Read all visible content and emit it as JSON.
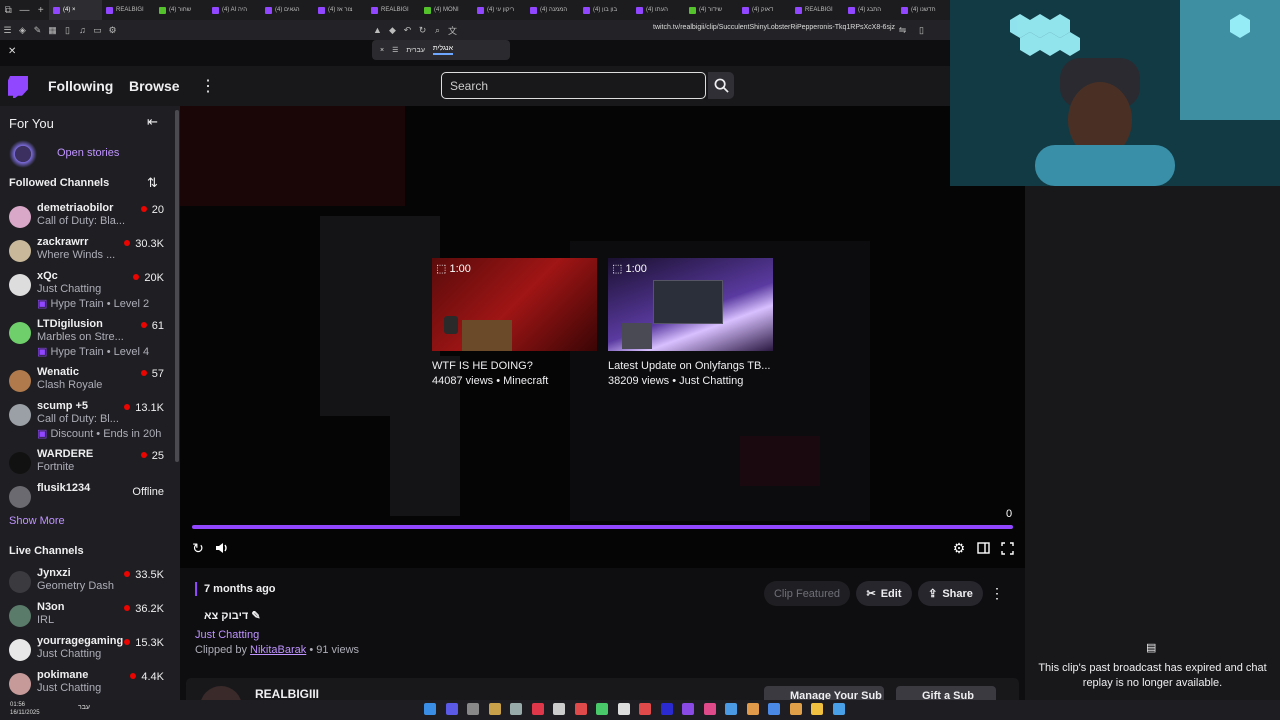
{
  "browser": {
    "tabs": [
      {
        "label": "(4) ×",
        "active": true,
        "color": "#9147ff"
      },
      {
        "label": "REALBIGI",
        "color": "#9147ff"
      },
      {
        "label": "(4) שחור",
        "color": "#53c22b"
      },
      {
        "label": "(4) AI היה",
        "color": "#9147ff"
      },
      {
        "label": "(4) הגאים",
        "color": "#9147ff"
      },
      {
        "label": "(4) צור אז",
        "color": "#9147ff"
      },
      {
        "label": "REALBIGI",
        "color": "#9147ff"
      },
      {
        "label": "(4) MONI",
        "color": "#53c22b"
      },
      {
        "label": "(4) ריקון עי",
        "color": "#9147ff"
      },
      {
        "label": "(4) הממנה",
        "color": "#9147ff"
      },
      {
        "label": "(4) בון בון",
        "color": "#9147ff"
      },
      {
        "label": "(4) העתו",
        "color": "#9147ff"
      },
      {
        "label": "(4) שידור",
        "color": "#53c22b"
      },
      {
        "label": "(4) דאוק",
        "color": "#9147ff"
      },
      {
        "label": "REALBIGI",
        "color": "#9147ff"
      },
      {
        "label": "(4) התבג",
        "color": "#9147ff"
      },
      {
        "label": "(4) חדשנו",
        "color": "#9147ff"
      }
    ],
    "url": "twitch.tv/realbigii/clip/SucculentShinyLobsterRiPepperonis-Tkq1RPsXcX8-6sjz",
    "translate": {
      "left": "עברית",
      "right": "אנגלית"
    }
  },
  "nav": {
    "following": "Following",
    "browse": "Browse",
    "search_placeholder": "Search"
  },
  "sidebar": {
    "for_you": "For You",
    "open_stories": "Open stories",
    "followed_header": "Followed Channels",
    "followed": [
      {
        "name": "demetriaobilor",
        "game": "Call of Duty: Bla...",
        "viewers": "20",
        "avatar": "#d9a7c7"
      },
      {
        "name": "zackrawrr",
        "game": "Where Winds ...",
        "viewers": "30.3K",
        "avatar": "#c9b99a"
      },
      {
        "name": "xQc",
        "game": "Just Chatting",
        "viewers": "20K",
        "extra": "Hype Train • Level 2",
        "avatar": "#dddddd"
      },
      {
        "name": "LTDigilusion",
        "game": "Marbles on Stre...",
        "viewers": "61",
        "extra": "Hype Train • Level 4",
        "avatar": "#6fcf6a"
      },
      {
        "name": "Wenatic",
        "game": "Clash Royale",
        "viewers": "57",
        "avatar": "#b07a4d"
      },
      {
        "name": "scump +5",
        "game": "Call of Duty: Bl...",
        "viewers": "13.1K",
        "extra": "Discount • Ends in 20h",
        "avatar": "#9aa0a6"
      },
      {
        "name": "WARDERE",
        "game": "Fortnite",
        "viewers": "25",
        "avatar": "#111111"
      },
      {
        "name": "flusik1234",
        "offline": "Offline",
        "avatar": "#6a6a70"
      }
    ],
    "show_more": "Show More",
    "live_header": "Live Channels",
    "live": [
      {
        "name": "Jynxzi",
        "game": "Geometry Dash",
        "viewers": "33.5K",
        "avatar": "#3a3a3f"
      },
      {
        "name": "N3on",
        "game": "IRL",
        "viewers": "36.2K",
        "avatar": "#5a7a6a"
      },
      {
        "name": "yourragegaming",
        "game": "Just Chatting",
        "viewers": "15.3K",
        "avatar": "#e8e8e8"
      },
      {
        "name": "pokimane",
        "game": "Just Chatting",
        "viewers": "4.4K",
        "avatar": "#c79a9a"
      }
    ]
  },
  "player": {
    "cards": [
      {
        "duration": "1:00",
        "title": "WTF IS HE DOING?",
        "meta": "44087 views • Minecraft"
      },
      {
        "duration": "1:00",
        "title": "Latest Update on Onlyfangs TB...",
        "meta": "38209 views • Just Chatting"
      }
    ],
    "progress_count": "0",
    "progress": 1.0,
    "accent": "#9147ff"
  },
  "clip": {
    "age": "7 months ago",
    "title": "דיבוק צא",
    "category": "Just Chatting",
    "clipped_by_prefix": "Clipped by ",
    "clipper": "NikitaBarak",
    "views_suffix": " • 91 views",
    "clip_featured": "Clip Featured",
    "edit": "Edit",
    "share": "Share",
    "channel": "REALBIGIII",
    "manage_sub": "Manage Your Sub",
    "gift_sub": "Gift a Sub"
  },
  "chat": {
    "message": "This clip's past broadcast has expired and chat replay is no longer available."
  },
  "taskbar": {
    "time": "01:56",
    "date": "16/11/2025",
    "lang": "עבר"
  }
}
